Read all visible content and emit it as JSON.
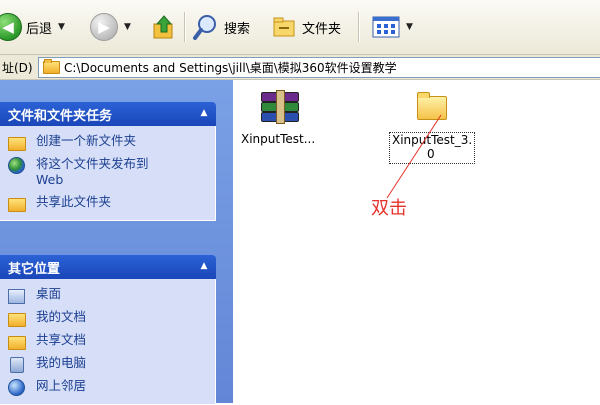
{
  "toolbar": {
    "back_label": "后退",
    "search_label": "搜索",
    "folders_label": "文件夹"
  },
  "address": {
    "label": "址(D)",
    "path": "C:\\Documents and Settings\\jill\\桌面\\模拟360软件设置教学"
  },
  "task_panel": {
    "title": "文件和文件夹任务",
    "items": [
      {
        "label": "创建一个新文件夹",
        "icon": "new-folder-icon"
      },
      {
        "label": "将这个文件夹发布到",
        "label2": "Web",
        "icon": "publish-web-icon"
      },
      {
        "label": "共享此文件夹",
        "icon": "share-folder-icon"
      }
    ]
  },
  "other_places": {
    "title": "其它位置",
    "items": [
      {
        "label": "桌面",
        "icon": "desktop-icon"
      },
      {
        "label": "我的文档",
        "icon": "my-documents-icon"
      },
      {
        "label": "共享文档",
        "icon": "shared-documents-icon"
      },
      {
        "label": "我的电脑",
        "icon": "my-computer-icon"
      },
      {
        "label": "网上邻居",
        "icon": "network-places-icon"
      }
    ]
  },
  "files": [
    {
      "label": "XinputTest...",
      "type": "rar-archive"
    },
    {
      "label_line1": "XinputTest_3.",
      "label_line2": "0",
      "type": "folder",
      "selected": true
    }
  ],
  "annotation": {
    "text": "双击",
    "color": "#e5322b"
  },
  "colors": {
    "pane_gradient_top": "#7aa1e6",
    "panel_header": "#2b62d6",
    "task_text": "#1c3f92"
  }
}
